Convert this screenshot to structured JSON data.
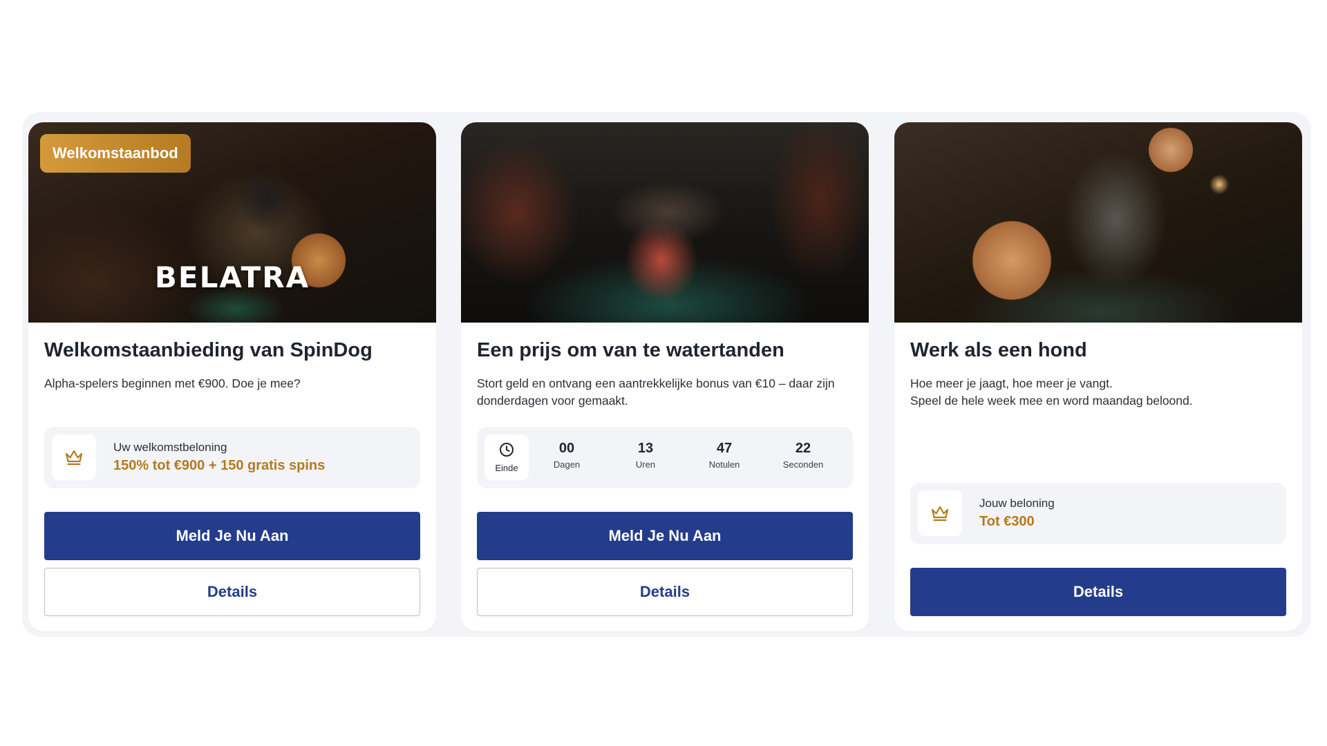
{
  "cards": [
    {
      "badge": "Welkomstaanbod",
      "image_text": "BELATRA",
      "title": "Welkomstaanbieding van SpinDog",
      "description": "Alpha-spelers beginnen met €900. Doe je mee?",
      "reward_label": "Uw welkomstbeloning",
      "reward_value": "150% tot €900 + 150 gratis spins",
      "primary_button": "Meld Je Nu Aan",
      "secondary_button": "Details"
    },
    {
      "title": "Een prijs om van te watertanden",
      "description": "Stort geld en ontvang een aantrekkelijke bonus van €10 – daar zijn donderdagen voor gemaakt.",
      "timer": {
        "end_label": "Einde",
        "units": [
          {
            "value": "00",
            "label": "Dagen"
          },
          {
            "value": "13",
            "label": "Uren"
          },
          {
            "value": "47",
            "label": "Notulen"
          },
          {
            "value": "22",
            "label": "Seconden"
          }
        ]
      },
      "primary_button": "Meld Je Nu Aan",
      "secondary_button": "Details"
    },
    {
      "title": "Werk als een hond",
      "description_lines": [
        "Hoe meer je jaagt, hoe meer je vangt.",
        "Speel de hele week mee en word maandag beloond."
      ],
      "reward_label": "Jouw beloning",
      "reward_value": "Tot €300",
      "primary_button": "Details"
    }
  ],
  "icons": {
    "reward": "crown-icon",
    "timer": "clock-icon"
  },
  "colors": {
    "primary": "#243c8c",
    "accent_gold": "#b57a1c",
    "badge_gold": "#d49a3a",
    "panel_bg": "#f3f4f7"
  }
}
